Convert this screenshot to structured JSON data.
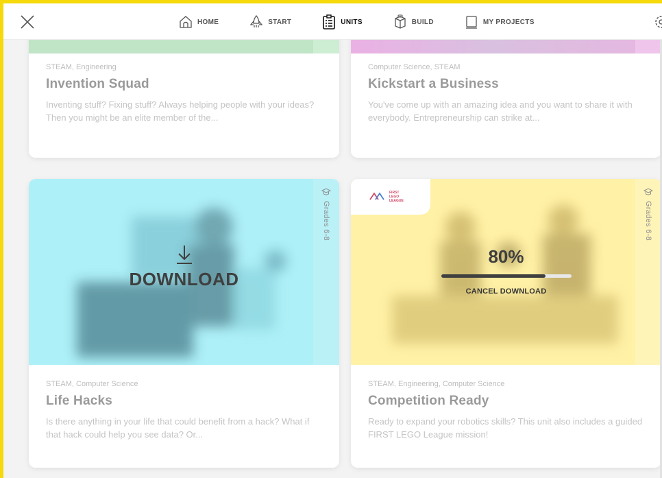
{
  "nav": {
    "items": [
      {
        "label": "HOME",
        "icon": "home-icon"
      },
      {
        "label": "START",
        "icon": "rocket-icon"
      },
      {
        "label": "UNITS",
        "icon": "clipboard-list-icon",
        "active": true
      },
      {
        "label": "BUILD",
        "icon": "cube-icon"
      },
      {
        "label": "MY PROJECTS",
        "icon": "folder-icon"
      }
    ]
  },
  "cards": {
    "invention": {
      "tags": "STEAM, Engineering",
      "title": "Invention Squad",
      "desc": "Inventing stuff? Fixing stuff? Always helping people with your ideas? Then you might be an elite member of the...",
      "color": "#bfe5c6"
    },
    "kickstart": {
      "tags": "Computer Science, STEAM",
      "title": "Kickstart a Business",
      "desc": "You've come up with an amazing idea and you want to share it with everybody. Entrepreneurship can strike at...",
      "color": "#eab1e4"
    },
    "lifehacks": {
      "tags": "STEAM, Computer Science",
      "title": "Life Hacks",
      "desc": "Is there anything in your life that could benefit from a hack? What if that hack could help you see data? Or...",
      "grade": "Grades 6-8",
      "action": "DOWNLOAD",
      "color": "#aef0f7"
    },
    "competition": {
      "tags": "STEAM, Engineering, Computer Science",
      "title": "Competition Ready",
      "desc": "Ready to expand your robotics skills? This unit also includes a guided FIRST LEGO League mission!",
      "grade": "Grades 6-8",
      "progress_text": "80%",
      "progress": 0.8,
      "cancel": "CANCEL DOWNLOAD",
      "badge": "FIRST LEGO LEAGUE",
      "color": "#fff1a6"
    }
  },
  "colors": {
    "frame": "#f5d90a"
  }
}
